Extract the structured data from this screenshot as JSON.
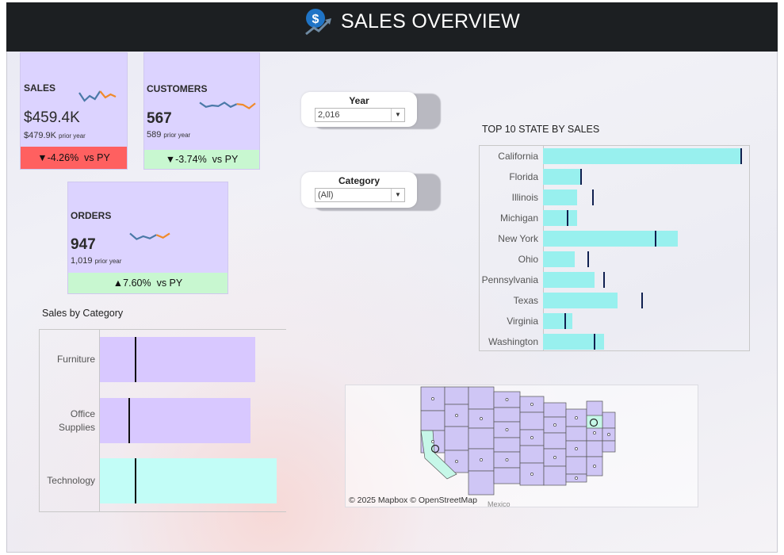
{
  "header": {
    "title": "SALES OVERVIEW",
    "icon": "dollar-trend-icon"
  },
  "kpis": {
    "sales": {
      "label": "SALES",
      "value": "$459.4K",
      "prior_value": "$479.9K",
      "prior_suffix": "prior year",
      "delta_text": "▼-4.26%",
      "delta_suffix": "vs PY",
      "trend": [
        0.7,
        0.2,
        0.5,
        0.3,
        0.8,
        0.4,
        0.6,
        0.45
      ]
    },
    "customers": {
      "label": "CUSTOMERS",
      "value": "567",
      "prior_value": "589",
      "prior_suffix": "prior year",
      "delta_text": "▼-3.74%",
      "delta_suffix": "vs PY",
      "trend": [
        0.7,
        0.4,
        0.5,
        0.45,
        0.7,
        0.4,
        0.6,
        0.55,
        0.3,
        0.65
      ]
    },
    "orders": {
      "label": "ORDERS",
      "value": "947",
      "prior_value": "1,019",
      "prior_suffix": "prior year",
      "delta_text": "▲7.60%",
      "delta_suffix": "vs PY",
      "trend": [
        0.7,
        0.3,
        0.5,
        0.35,
        0.6,
        0.4,
        0.7
      ]
    }
  },
  "filters": {
    "year": {
      "title": "Year",
      "value": "2,016"
    },
    "category": {
      "title": "Category",
      "value": "(All)"
    }
  },
  "state_chart": {
    "title": "TOP 10 STATE BY SALES",
    "states": [
      {
        "name": "California",
        "value": 88,
        "ref": 88
      },
      {
        "name": "Florida",
        "value": 17,
        "ref": 17
      },
      {
        "name": "Illinois",
        "value": 15,
        "ref": 22
      },
      {
        "name": "Michigan",
        "value": 15,
        "ref": 11
      },
      {
        "name": "New York",
        "value": 60,
        "ref": 50
      },
      {
        "name": "Ohio",
        "value": 14,
        "ref": 20
      },
      {
        "name": "Pennsylvania",
        "value": 23,
        "ref": 27
      },
      {
        "name": "Texas",
        "value": 33,
        "ref": 44
      },
      {
        "name": "Virginia",
        "value": 13,
        "ref": 10
      },
      {
        "name": "Washington",
        "value": 27,
        "ref": 23
      }
    ],
    "bar_color": "#98f0ee",
    "ref_color": "#102050"
  },
  "category_chart": {
    "title": "Sales by Category",
    "categories": [
      {
        "name": "Furniture",
        "value": 196,
        "ref": 44,
        "color": "#d8c8ff"
      },
      {
        "name": "Office\nSupplies",
        "value": 190,
        "ref": 36,
        "color": "#d8c8ff"
      },
      {
        "name": "Technology",
        "value": 223,
        "ref": 44,
        "color": "#c2fdf7"
      }
    ]
  },
  "map": {
    "credit": "© 2025 Mapbox © OpenStreetMap",
    "mexico_label": "Mexico",
    "state_fill": "#cfc6f5",
    "highlight_fill": "#c6f7e8"
  },
  "colors": {
    "header_bg": "#1c1f22",
    "kpi_bg": "#dcd3ff",
    "neg": "#ff6060",
    "pos": "#c8f7d0",
    "spark_a": "#4b79a8",
    "spark_b": "#f08a2a"
  }
}
